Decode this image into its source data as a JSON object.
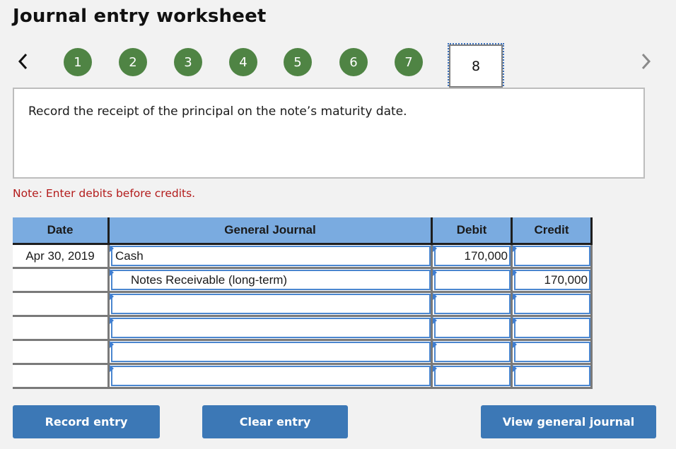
{
  "header": {
    "title": "Journal entry worksheet"
  },
  "navigation": {
    "prev_icon": "chevron-left-icon",
    "next_icon": "chevron-right-icon",
    "steps": [
      {
        "label": "1",
        "status": "completed"
      },
      {
        "label": "2",
        "status": "completed"
      },
      {
        "label": "3",
        "status": "completed"
      },
      {
        "label": "4",
        "status": "completed"
      },
      {
        "label": "5",
        "status": "completed"
      },
      {
        "label": "6",
        "status": "completed"
      },
      {
        "label": "7",
        "status": "completed"
      },
      {
        "label": "8",
        "status": "current"
      }
    ],
    "completed_color": "#4f8444"
  },
  "prompt": {
    "text": "Record the receipt of the principal on the note’s maturity date."
  },
  "note": {
    "text": "Note: Enter debits before credits.",
    "color": "#b31b1b"
  },
  "journal": {
    "headers": {
      "date": "Date",
      "general_journal": "General Journal",
      "debit": "Debit",
      "credit": "Credit"
    },
    "rows": [
      {
        "date": "Apr 30, 2019",
        "account": "Cash",
        "debit": "170,000",
        "credit": ""
      },
      {
        "date": "",
        "account": "Notes Receivable (long-term)",
        "debit": "",
        "credit": "170,000"
      },
      {
        "date": "",
        "account": "",
        "debit": "",
        "credit": ""
      },
      {
        "date": "",
        "account": "",
        "debit": "",
        "credit": ""
      },
      {
        "date": "",
        "account": "",
        "debit": "",
        "credit": ""
      },
      {
        "date": "",
        "account": "",
        "debit": "",
        "credit": ""
      }
    ],
    "header_color": "#7aabe0"
  },
  "buttons": {
    "record": "Record entry",
    "clear": "Clear entry",
    "view": "View general journal",
    "color": "#3c78b6"
  }
}
